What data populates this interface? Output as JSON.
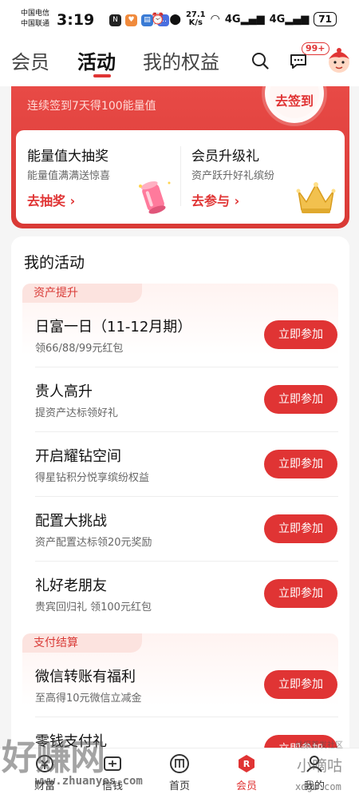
{
  "status_bar": {
    "carrier_1": "中国电信",
    "carrier_2": "中国联通",
    "time": "3:19",
    "speed_value": "27.1",
    "speed_unit": "K/s",
    "battery": "71"
  },
  "header": {
    "tabs": [
      {
        "label": "会员"
      },
      {
        "label": "活动"
      },
      {
        "label": "我的权益"
      }
    ],
    "message_badge": "99+"
  },
  "top_card": {
    "subtitle": "连续签到7天得100能量值",
    "sign_button": "去签到",
    "promos": [
      {
        "title": "能量值大抽奖",
        "desc": "能量值满满送惊喜",
        "link": "去抽奖"
      },
      {
        "title": "会员升级礼",
        "desc": "资产跃升好礼缤纷",
        "link": "去参与"
      }
    ]
  },
  "my_activities": {
    "title": "我的活动",
    "join_label": "立即参加",
    "sections": [
      {
        "tag": "资产提升",
        "items": [
          {
            "title": "日富一日（11-12月期）",
            "desc": "领66/88/99元红包"
          },
          {
            "title": "贵人高升",
            "desc": "提资产达标领好礼"
          },
          {
            "title": "开启耀钻空间",
            "desc": "得星钻积分悦享缤纷权益"
          },
          {
            "title": "配置大挑战",
            "desc": "资产配置达标领20元奖励"
          },
          {
            "title": "礼好老朋友",
            "desc": "贵宾回归礼 领100元红包"
          }
        ]
      },
      {
        "tag": "支付结算",
        "items": [
          {
            "title": "微信转账有福利",
            "desc": "至高得10元微信立减金"
          },
          {
            "title": "零钱支付礼",
            "desc": ""
          }
        ]
      }
    ]
  },
  "bottom_nav": {
    "items": [
      {
        "label": "财富"
      },
      {
        "label": "信钱"
      },
      {
        "label": "首页"
      },
      {
        "label": "会员"
      },
      {
        "label": "我的"
      }
    ]
  },
  "watermarks": {
    "left_brand": "好赚网",
    "left_url": "www.zhuanyes.com",
    "right_small": "线报首发社区",
    "right_brand": "小嘀咕",
    "right_url": "xdgu.com"
  },
  "colors": {
    "accent": "#e03434",
    "card_red": "#e84a46"
  }
}
